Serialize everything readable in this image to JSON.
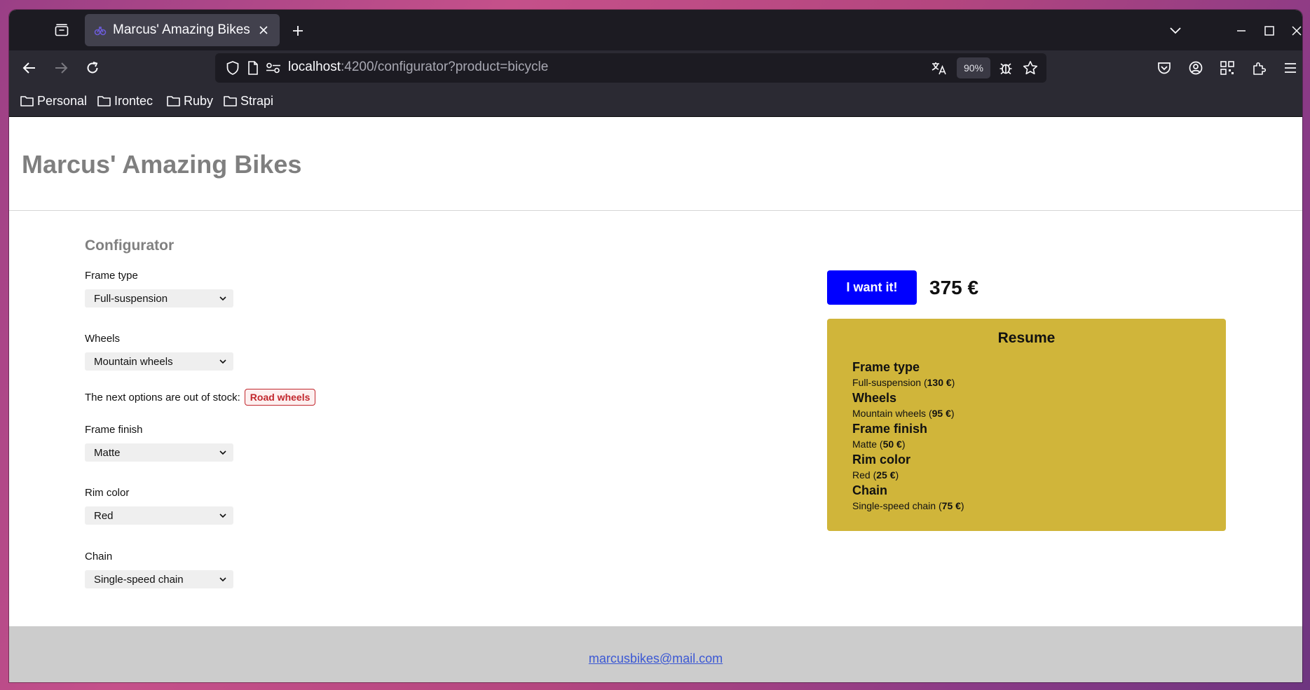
{
  "browser": {
    "tab_title": "Marcus' Amazing Bikes",
    "url_host": "localhost",
    "url_rest": ":4200/configurator?product=bicycle",
    "zoom": "90%",
    "bookmarks": [
      "Personal",
      "Irontec",
      "Ruby",
      "Strapi"
    ]
  },
  "site": {
    "title": "Marcus' Amazing Bikes"
  },
  "configurator": {
    "heading": "Configurator",
    "fields": [
      {
        "label": "Frame type",
        "value": "Full-suspension"
      },
      {
        "label": "Wheels",
        "value": "Mountain wheels"
      },
      {
        "label": "Frame finish",
        "value": "Matte"
      },
      {
        "label": "Rim color",
        "value": "Red"
      },
      {
        "label": "Chain",
        "value": "Single-speed chain"
      }
    ],
    "out_of_stock_text": "The next options are out of stock:",
    "out_of_stock_items": [
      "Road wheels"
    ]
  },
  "order": {
    "button_label": "I want it!",
    "price": "375 €"
  },
  "resume": {
    "title": "Resume",
    "items": [
      {
        "name": "Frame type",
        "value": "Full-suspension",
        "price": "130 €"
      },
      {
        "name": "Wheels",
        "value": "Mountain wheels",
        "price": "95 €"
      },
      {
        "name": "Frame finish",
        "value": "Matte",
        "price": "50 €"
      },
      {
        "name": "Rim color",
        "value": "Red",
        "price": "25 €"
      },
      {
        "name": "Chain",
        "value": "Single-speed chain",
        "price": "75 €"
      }
    ]
  },
  "footer": {
    "email": "marcusbikes@mail.com"
  },
  "colors": {
    "primary_button": "#0000ff",
    "resume_background": "#d0b53a",
    "out_of_stock": "#c2272d",
    "footer_background": "#cccccc"
  }
}
